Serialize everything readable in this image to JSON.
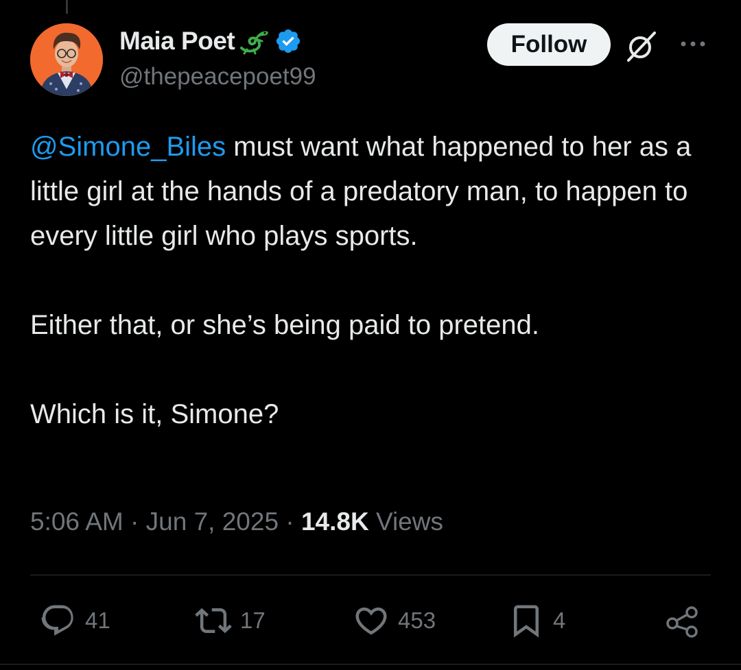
{
  "author": {
    "display_name": "Maia Poet",
    "handle": "@thepeacepoet99"
  },
  "follow_label": "Follow",
  "tweet": {
    "mention": "@Simone_Biles",
    "line1_rest": " must want what happened to her as a little girl at the hands of a predatory man, to happen to every little girl who plays sports.",
    "paragraph2": "Either that, or she’s being paid to pretend.",
    "paragraph3": "Which is it, Simone?"
  },
  "meta": {
    "time": "5:06 AM",
    "sep1": " · ",
    "date": "Jun 7, 2025",
    "sep2": " · ",
    "views_count": "14.8K",
    "views_label": " Views"
  },
  "actions": {
    "replies": "41",
    "reposts": "17",
    "likes": "453",
    "bookmarks": "4"
  },
  "colors": {
    "background": "#000000",
    "text": "#e7e9ea",
    "secondary": "#71767b",
    "link": "#1d9bf0",
    "verified": "#1d9bf0",
    "lizard": "#3fae49"
  },
  "icons": [
    "lizard-emoji-icon",
    "verified-badge-icon",
    "grok-icon",
    "more-icon",
    "reply-icon",
    "repost-icon",
    "like-icon",
    "bookmark-icon",
    "share-icon"
  ]
}
